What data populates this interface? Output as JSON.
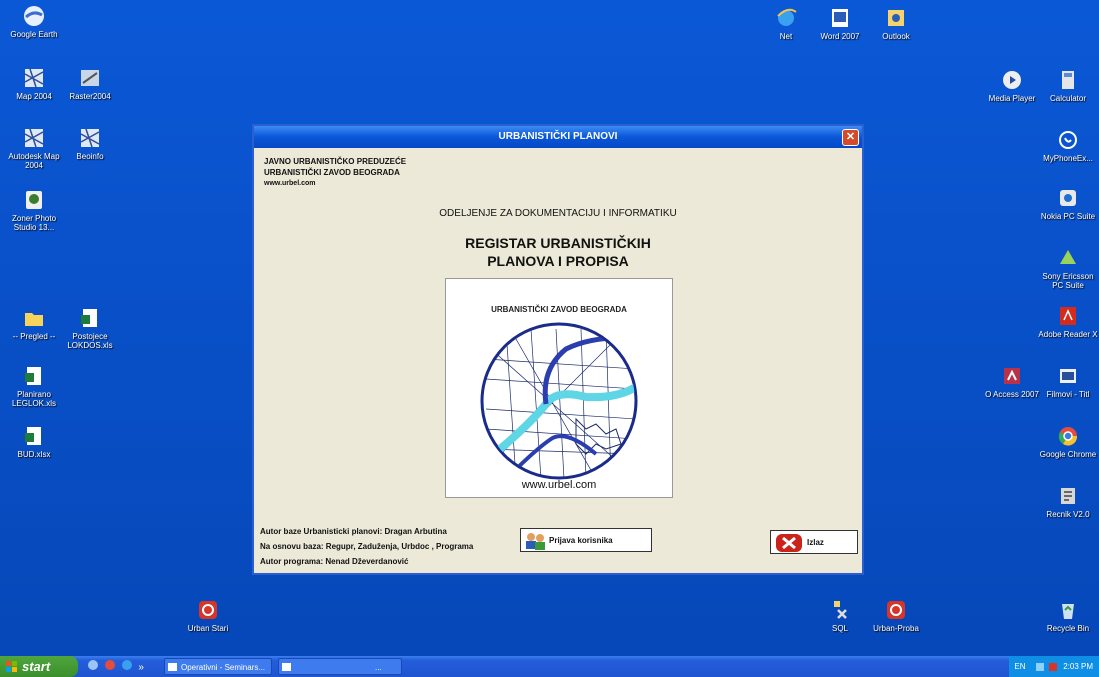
{
  "desktop": {
    "icons": [
      {
        "label": "Google Earth",
        "icon": "google-earth-icon"
      },
      {
        "label": "Map 2004",
        "icon": "map-icon"
      },
      {
        "label": "Raster2004",
        "icon": "raster-icon"
      },
      {
        "label": "Autodesk Map 2004",
        "icon": "autodesk-map-icon"
      },
      {
        "label": "Beoinfo",
        "icon": "beoinfo-icon"
      },
      {
        "label": "Zoner Photo Studio 13...",
        "icon": "zoner-icon"
      },
      {
        "label": "-- Pregled --",
        "icon": "folder-icon"
      },
      {
        "label": "Postojece LOKDOS.xls",
        "icon": "excel-icon"
      },
      {
        "label": "Planirano LEGLOK.xls",
        "icon": "excel-icon"
      },
      {
        "label": "BUD.xlsx",
        "icon": "excel-icon"
      },
      {
        "label": "Net",
        "icon": "ie-icon"
      },
      {
        "label": "Word 2007",
        "icon": "word-icon"
      },
      {
        "label": "Outlook",
        "icon": "outlook-icon"
      },
      {
        "label": "Media Player",
        "icon": "media-player-icon"
      },
      {
        "label": "Calculator",
        "icon": "calculator-icon"
      },
      {
        "label": "MyPhoneEx...",
        "icon": "phone-icon"
      },
      {
        "label": "Nokia PC Suite",
        "icon": "nokia-icon"
      },
      {
        "label": "Sony Ericsson PC Suite",
        "icon": "sony-icon"
      },
      {
        "label": "Adobe Reader X",
        "icon": "adobe-icon"
      },
      {
        "label": "O Access 2007",
        "icon": "access-icon"
      },
      {
        "label": "Filmovi - Titl",
        "icon": "film-icon"
      },
      {
        "label": "Google Chrome",
        "icon": "chrome-icon"
      },
      {
        "label": "Recnik V2.0",
        "icon": "dictionary-icon"
      },
      {
        "label": "Urban Stari",
        "icon": "urban-icon"
      },
      {
        "label": "SQL",
        "icon": "sql-icon"
      },
      {
        "label": "Urban-Proba",
        "icon": "urban-icon"
      },
      {
        "label": "Recycle Bin",
        "icon": "recycle-bin-icon"
      }
    ]
  },
  "dialog": {
    "title": "URBANISTIČKI PLANOVI",
    "close_glyph": "✕",
    "org_line1": "JAVNO URBANISTIČKO PREDUZEĆE",
    "org_line2": "URBANISTIČKI ZAVOD BEOGRADA",
    "org_url": "www.urbel.com",
    "department": "ODELJENJE ZA DOKUMENTACIJU I INFORMATIKU",
    "register_line1": "REGISTAR URBANISTIČKIH",
    "register_line2": "PLANOVA I PROPISA",
    "logo_title": "URBANISTIČKI ZAVOD BEOGRADA",
    "logo_url": "www.urbel.com",
    "credit1": "Autor baze Urbanisticki planovi: Dragan Arbutina",
    "credit2": "Na osnovu baza: Regupr, Zaduženja, Urbdoc , Programa",
    "credit3": "Autor programa: Nenad Dževerdanović",
    "login_label": "Prijava korisnika",
    "exit_label": "Izlaz"
  },
  "taskbar": {
    "start_label": "start",
    "quick_more": "»",
    "task1": "Operativni - Seminars...",
    "task2": "...",
    "tray_lang": "EN",
    "clock": "2:03 PM"
  },
  "colors": {
    "desktop": "#0a4fc4",
    "dialog_bg": "#ece9d8",
    "titlebar": "#0a57d8",
    "start_green": "#3c8f2d"
  }
}
